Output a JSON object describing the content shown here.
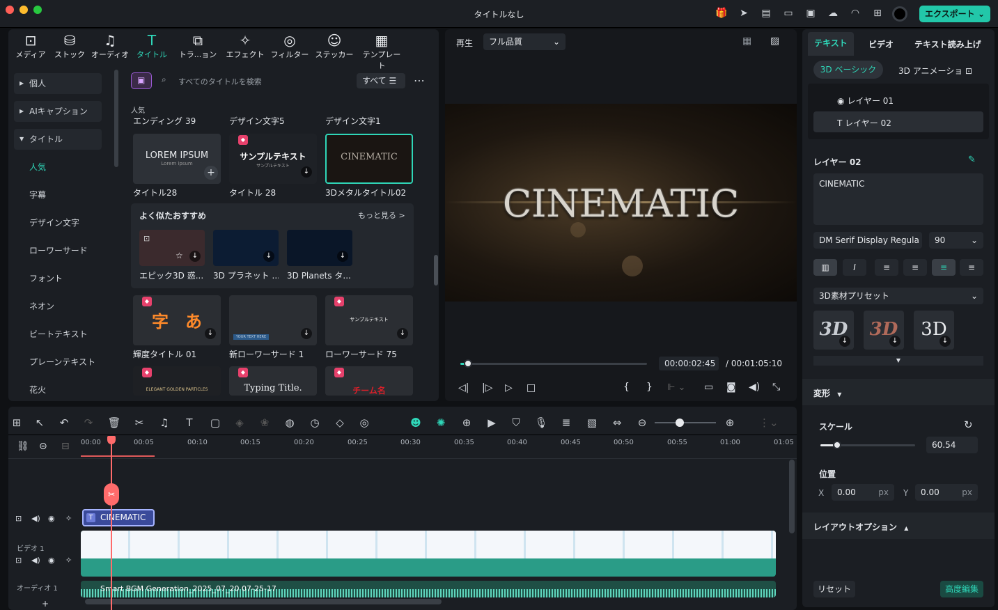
{
  "app": {
    "title": "タイトルなし",
    "export_label": "エクスポート"
  },
  "top_tabs": [
    {
      "label": "メディア"
    },
    {
      "label": "ストック"
    },
    {
      "label": "オーディオ"
    },
    {
      "label": "タイトル"
    },
    {
      "label": "トラ...ョン"
    },
    {
      "label": "エフェクト"
    },
    {
      "label": "フィルター"
    },
    {
      "label": "ステッカー"
    },
    {
      "label": "テンプレート"
    }
  ],
  "sidebar": {
    "items": [
      {
        "label": "個人"
      },
      {
        "label": "AIキャプション"
      },
      {
        "label": "タイトル"
      },
      {
        "label": "人気"
      },
      {
        "label": "字幕"
      },
      {
        "label": "デザイン文字"
      },
      {
        "label": "ローワーサード"
      },
      {
        "label": "フォント"
      },
      {
        "label": "ネオン"
      },
      {
        "label": "ビートテキスト"
      },
      {
        "label": "プレーンテキスト"
      },
      {
        "label": "花火"
      }
    ]
  },
  "search": {
    "placeholder": "すべてのタイトルを検索",
    "filter_label": "すべて"
  },
  "section_label": "人気",
  "row1_headers": [
    "エンディング 39",
    "デザイン文字5",
    "デザイン文字1"
  ],
  "row1": [
    {
      "thumb": "LOREM IPSUM",
      "thumb_sub": "Lorem ipsum",
      "caption": "タイトル28"
    },
    {
      "thumb": "サンプルテキスト",
      "thumb_sub": "サンプルテキスト",
      "caption": "タイトル 28"
    },
    {
      "thumb": "CINEMATIC",
      "caption": "3Dメタルタイトル02"
    }
  ],
  "similar": {
    "title": "よく似たおすすめ",
    "more": "もっと見る >",
    "items": [
      {
        "caption": "エピック3D 惑..."
      },
      {
        "caption": "3D プラネット ..."
      },
      {
        "caption": "3D Planets タ..."
      }
    ]
  },
  "row2": [
    {
      "thumb": "字　あ",
      "caption": "輝度タイトル 01"
    },
    {
      "thumb": "YOUR TEXT HERE",
      "caption": "新ローワーサード 1"
    },
    {
      "thumb": "サンプルテキスト",
      "caption": "ローワーサード 75"
    }
  ],
  "row3": [
    {
      "thumb": "ELEGANT GOLDEN PARTICLES"
    },
    {
      "thumb": "Typing Title."
    },
    {
      "thumb": "チーム名"
    }
  ],
  "preview": {
    "label": "再生",
    "quality": "フル品質",
    "text": "CINEMATIC",
    "current_time": "00:00:02:45",
    "total_time": "/ 00:01:05:10",
    "progress": 0.04
  },
  "right": {
    "tabs": [
      "テキスト",
      "ビデオ",
      "テキスト読み上げ"
    ],
    "subtabs": [
      "3D ベーシック",
      "3D アニメーショ"
    ],
    "layers": [
      "レイヤー 01",
      "レイヤー 02"
    ],
    "layer_heading": "レイヤー 02",
    "text_value": "CINEMATIC",
    "font": "DM Serif Display Regula",
    "font_size": "90",
    "preset_label": "3D素材プリセット",
    "presets": [
      "3D",
      "3D",
      "3D"
    ],
    "transform_label": "変形",
    "scale_label": "スケール",
    "scale_value": "60.54",
    "scale_level": 0.18,
    "position_label": "位置",
    "x_label": "X",
    "x_value": "0.00",
    "y_label": "Y",
    "y_value": "0.00",
    "unit": "px",
    "layout_label": "レイアウトオプション",
    "reset_label": "リセット",
    "advanced_label": "高度編集"
  },
  "timeline": {
    "ruler": [
      "00:00",
      "00:05",
      "00:10",
      "00:15",
      "00:20",
      "00:25",
      "00:30",
      "00:35",
      "00:40",
      "00:45",
      "00:50",
      "00:55",
      "01:00",
      "01:05"
    ],
    "title_clip": "CINEMATIC",
    "video_track_label": "ビデオ 1",
    "audio_track_label": "オーディオ 1",
    "audio_clip": "Smart BGM Generation_2025_07_20 07-25-17"
  }
}
